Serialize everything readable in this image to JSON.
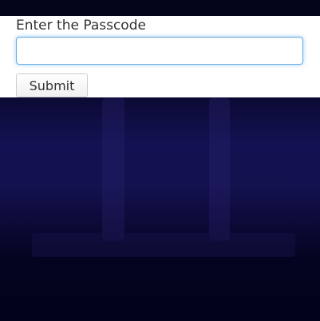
{
  "form": {
    "label": "Enter the Passcode",
    "input_value": "",
    "input_placeholder": "",
    "submit_label": "Submit"
  },
  "colors": {
    "page_background": "#03031a",
    "panel_background": "#ffffff",
    "backdrop_mid": "#141152",
    "input_focus_border": "#66afe9"
  }
}
